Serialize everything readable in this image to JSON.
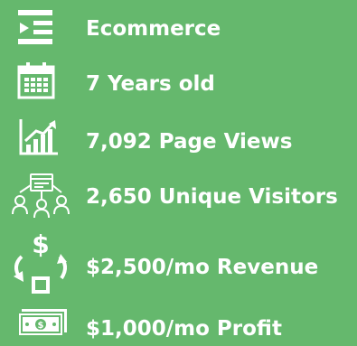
{
  "features": [
    {
      "icon": "category-list-icon",
      "label": "Ecommerce"
    },
    {
      "icon": "calendar-icon",
      "label": "7 Years old"
    },
    {
      "icon": "growth-chart-icon",
      "label": "7,092 Page Views"
    },
    {
      "icon": "visitors-network-icon",
      "label": "2,650 Unique Visitors"
    },
    {
      "icon": "revenue-cycle-icon",
      "label": "$2,500/mo Revenue"
    },
    {
      "icon": "money-bill-icon",
      "label": "$1,000/mo Profit"
    }
  ],
  "colors": {
    "background": "#65b86d",
    "foreground": "#ffffff"
  }
}
